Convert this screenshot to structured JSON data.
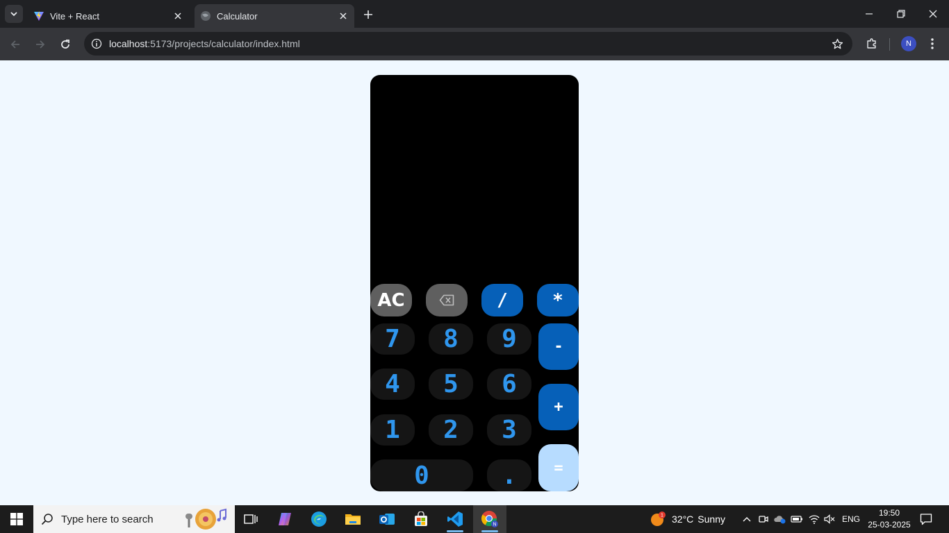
{
  "browser": {
    "tabs": [
      {
        "title": "Vite + React",
        "favicon": "vite-icon",
        "active": false
      },
      {
        "title": "Calculator",
        "favicon": "globe-icon",
        "active": true
      }
    ],
    "url_host": "localhost",
    "url_path": ":5173/projects/calculator/index.html",
    "profile_initial": "N"
  },
  "calculator": {
    "display_value": "",
    "keys": {
      "ac": "AC",
      "divide": "/",
      "multiply": "*",
      "subtract": "-",
      "add": "+",
      "equals": "=",
      "decimal": ".",
      "n0": "0",
      "n1": "1",
      "n2": "2",
      "n3": "3",
      "n4": "4",
      "n5": "5",
      "n6": "6",
      "n7": "7",
      "n8": "8",
      "n9": "9"
    },
    "colors": {
      "background": "#000000",
      "number_text": "#2f96ee",
      "number_bg": "#151515",
      "operator_bg": "#0660b8",
      "function_bg": "#5f5f5f",
      "equals_bg": "#b7dcff",
      "page_bg": "#f0f8ff"
    }
  },
  "taskbar": {
    "search_placeholder": "Type here to search",
    "weather_temp": "32°C",
    "weather_desc": "Sunny",
    "weather_badge": "1",
    "language": "ENG",
    "time": "19:50",
    "date": "25-03-2025"
  }
}
